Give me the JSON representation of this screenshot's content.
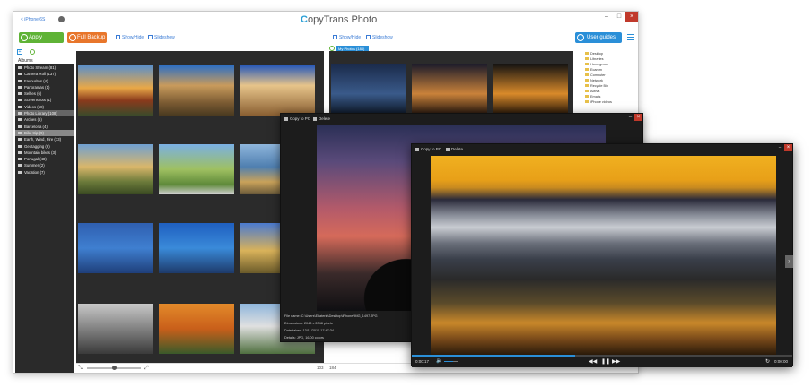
{
  "app": {
    "device": "< iPhone 6S",
    "logo_prefix": "C",
    "logo_rest": "opyTrans Photo"
  },
  "toolbar": {
    "apply_label": "Apply changes",
    "backup_label": "Full Backup",
    "showhide_left": "Show/Hide",
    "slideshow_left": "Slideshow",
    "showhide_right": "Show/Hide",
    "slideshow_right": "Slideshow",
    "guides_label": "User guides"
  },
  "sidebar": {
    "title": "Albums",
    "items": [
      "Photo Stream (81)",
      "Camera Roll (137)",
      "Favourites (4)",
      "Panoramas (1)",
      "Selfies (6)",
      "Screenshots (1)",
      "Videos (58)",
      "Photo Library (108)",
      "Arches (5)",
      "Barcelona (4)",
      "Bike trip (9)",
      "Earth, Wind, Fire (13)",
      "Geotagging (6)",
      "Mountain bikes (3)",
      "Portugal (48)",
      "Summer (2)",
      "Vacation (7)"
    ]
  },
  "right_tab": "My Photos (184)",
  "right_pane": {
    "items": [
      "Desktop",
      "Libraries",
      "Homegroup",
      "Ecamm",
      "Computer",
      "Network",
      "Recycle Bin",
      "Activa",
      "Emails",
      "iPhone videos"
    ]
  },
  "status": {
    "left_count": "103",
    "right_count": "184"
  },
  "viewer1": {
    "copy_label": "Copy to PC",
    "delete_label": "Delete",
    "filename": "File name: C:\\Users\\Ekaterin\\Desktop\\iPhone\\IMG_1497.JPG",
    "dimensions": "Dimensions: 2048 x 2048 pixels",
    "date": "Date taken: 13/11/2015 17:47:34",
    "details": "Details: JPG, 16.00 colors"
  },
  "viewer2": {
    "copy_label": "Copy to PC",
    "delete_label": "Delete",
    "time_current": "0:00:17",
    "time_total": "0:00:00",
    "progress": 0.43,
    "volume": 0.6
  },
  "colors": {
    "green": "#5fb336",
    "orange": "#e8762b",
    "blue": "#2a8fd8",
    "close": "#c0392b"
  }
}
